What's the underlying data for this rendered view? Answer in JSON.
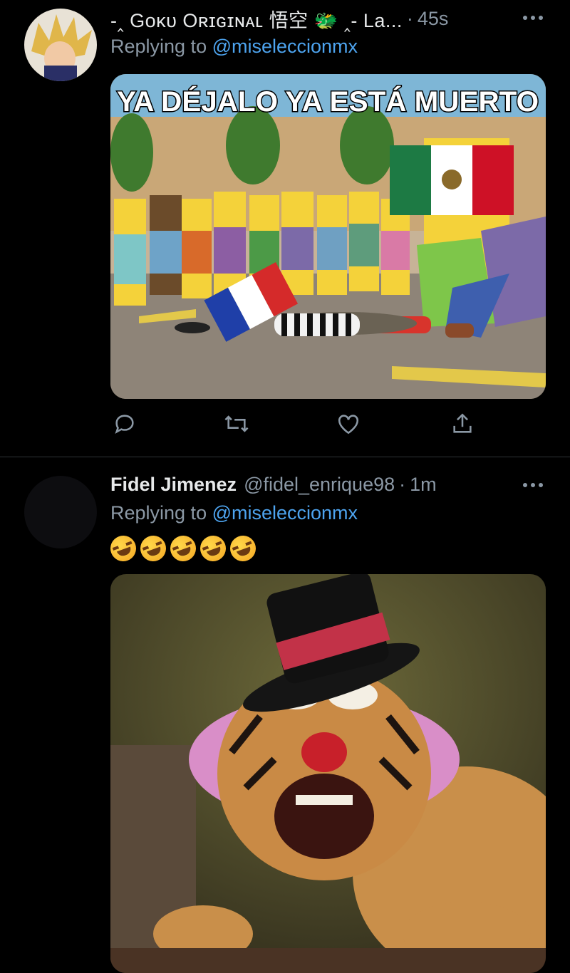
{
  "tweets": [
    {
      "display_name": "-‸ Gᴏᴋᴜ Oʀɪɢɪɴᴀʟ 悟空 🐲 ‸- La...",
      "time": "45s",
      "dot": "·",
      "replying_prefix": "Replying to ",
      "replying_to": "@miseleccionmx",
      "meme_caption": "YA DÉJALO YA ESTÁ MUERTO"
    },
    {
      "display_name": "Fidel Jimenez",
      "handle": "@fidel_enrique98",
      "time": "1m",
      "dot": "·",
      "replying_prefix": "Replying to ",
      "replying_to": "@miseleccionmx",
      "emoji_text": "🤣🤣🤣🤣🤣"
    }
  ],
  "icons": [
    "more-icon",
    "reply-icon",
    "retweet-icon",
    "like-icon",
    "share-icon"
  ],
  "colors": {
    "background": "#000000",
    "mention": "#4da3ee",
    "muted": "#8b98a5",
    "divider": "#2f3336"
  }
}
